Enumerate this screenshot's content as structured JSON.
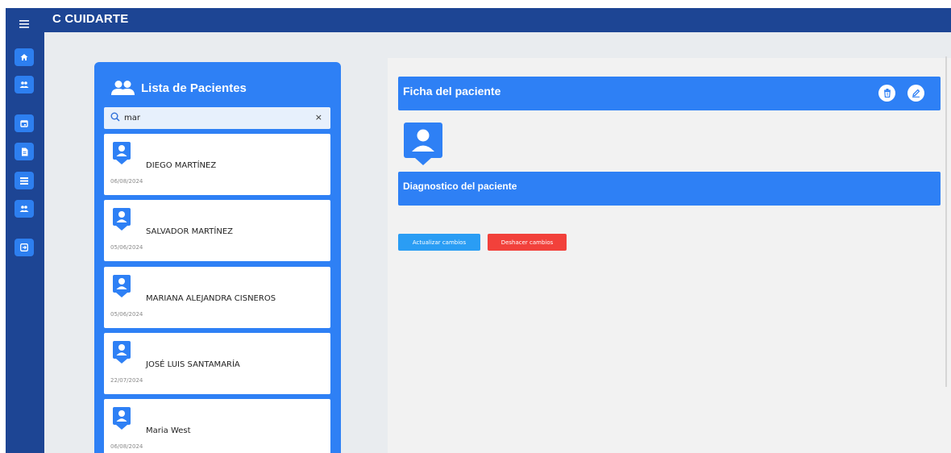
{
  "app": {
    "title": "C CUIDARTE"
  },
  "sidebar": {
    "menu_icon": "hamburger-icon",
    "items": [
      {
        "icon": "home-icon"
      },
      {
        "icon": "people-icon"
      },
      {
        "icon": "calendar-icon"
      },
      {
        "icon": "document-icon"
      },
      {
        "icon": "list-icon"
      },
      {
        "icon": "people-icon"
      },
      {
        "icon": "logout-icon"
      }
    ]
  },
  "patient_list": {
    "title": "Lista de Pacientes",
    "search": {
      "value": "mar",
      "clear": "×"
    },
    "patients": [
      {
        "name": "DIEGO MARTÍNEZ",
        "date": "06/08/2024"
      },
      {
        "name": "SALVADOR MARTÍNEZ",
        "date": "05/06/2024"
      },
      {
        "name": "MARIANA ALEJANDRA CISNEROS",
        "date": "05/06/2024"
      },
      {
        "name": "JOSÉ LUIS SANTAMARÍA",
        "date": "22/07/2024"
      },
      {
        "name": "Maria West",
        "date": "06/08/2024"
      }
    ]
  },
  "detail": {
    "record_title": "Ficha del paciente",
    "diagnosis_title": "Diagnostico del paciente",
    "update_label": "Actualizar cambios",
    "undo_label": "Deshacer cambios"
  },
  "colors": {
    "navy": "#1d4594",
    "primary": "#2e80f5",
    "update": "#2a9df4",
    "danger": "#f2413b"
  }
}
